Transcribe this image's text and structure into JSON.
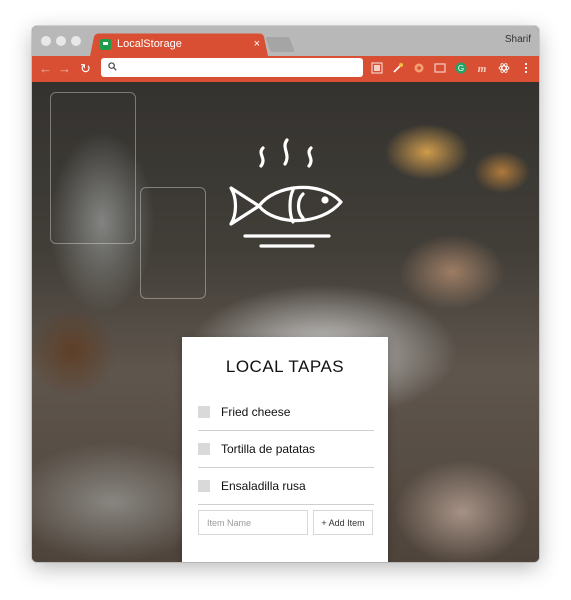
{
  "browser": {
    "tab_title": "LocalStorage",
    "tab_close": "×",
    "user_name": "Sharif",
    "nav": {
      "back": "←",
      "forward": "→",
      "reload": "↻"
    },
    "address": ""
  },
  "extensions": [
    "screenshot-icon",
    "eyedropper-icon",
    "gear-icon",
    "window-icon",
    "grammarly-icon",
    "m-icon",
    "react-icon",
    "menu-icon"
  ],
  "app": {
    "title": "LOCAL TAPAS",
    "items": [
      {
        "label": "Fried cheese",
        "checked": false
      },
      {
        "label": "Tortilla de patatas",
        "checked": false
      },
      {
        "label": "Ensaladilla rusa",
        "checked": false
      }
    ],
    "input_placeholder": "Item Name",
    "input_value": "",
    "add_button_label": "+ Add Item"
  },
  "colors": {
    "accent": "#d94f33",
    "titlebar": "#b8b8b8",
    "checkbox": "#d9d9d9"
  }
}
